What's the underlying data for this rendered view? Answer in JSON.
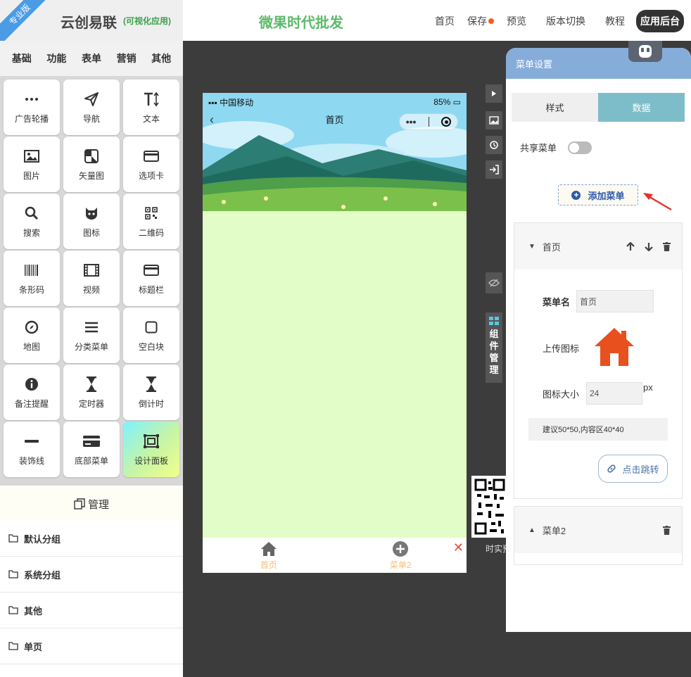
{
  "header": {
    "edition_ribbon": "专业版",
    "brand_name": "云创易联",
    "brand_sub": "(可视化应用)",
    "site_title": "微果时代批发",
    "nav": {
      "home": "首页",
      "save": "保存",
      "preview": "预览",
      "version_switch": "版本切换",
      "tutorial": "教程",
      "admin": "应用后台"
    }
  },
  "sidebar": {
    "category_tabs": [
      "基础",
      "功能",
      "表单",
      "营销",
      "其他"
    ],
    "components": [
      {
        "label": "广告轮播",
        "icon": "more-dots-icon"
      },
      {
        "label": "导航",
        "icon": "paper-plane-icon"
      },
      {
        "label": "文本",
        "icon": "text-size-icon"
      },
      {
        "label": "图片",
        "icon": "image-icon"
      },
      {
        "label": "矢量图",
        "icon": "vector-icon"
      },
      {
        "label": "选项卡",
        "icon": "card-icon"
      },
      {
        "label": "搜索",
        "icon": "search-icon"
      },
      {
        "label": "图标",
        "icon": "github-icon"
      },
      {
        "label": "二维码",
        "icon": "qrcode-icon"
      },
      {
        "label": "条形码",
        "icon": "barcode-icon"
      },
      {
        "label": "视频",
        "icon": "film-icon"
      },
      {
        "label": "标题栏",
        "icon": "titlebar-icon"
      },
      {
        "label": "地图",
        "icon": "compass-icon"
      },
      {
        "label": "分类菜单",
        "icon": "menu-lines-icon"
      },
      {
        "label": "空白块",
        "icon": "blank-square-icon"
      },
      {
        "label": "备注提醒",
        "icon": "info-icon"
      },
      {
        "label": "定时器",
        "icon": "hourglass-icon"
      },
      {
        "label": "倒计时",
        "icon": "hourglass-icon"
      },
      {
        "label": "装饰线",
        "icon": "divider-line-icon"
      },
      {
        "label": "底部菜单",
        "icon": "bottom-menu-icon"
      },
      {
        "label": "设计面板",
        "icon": "design-panel-icon"
      }
    ],
    "manage_label": "管理",
    "groups": [
      "默认分组",
      "系统分组",
      "其他",
      "单页"
    ]
  },
  "phone": {
    "status": {
      "carrier": "中国移动",
      "battery": "85%"
    },
    "nav_title": "首页",
    "tabs": [
      {
        "label": "首页",
        "icon": "home-icon"
      },
      {
        "label": "菜单2",
        "icon": "plus-circle-icon"
      }
    ]
  },
  "tools": {
    "component_manage": [
      "组",
      "件",
      "管",
      "理"
    ],
    "qr_label": "时实预"
  },
  "panel": {
    "title": "菜单设置",
    "seg_style": "样式",
    "seg_data": "数据",
    "share_label": "共享菜单",
    "add_menu": "添加菜单",
    "menu1": {
      "title": "首页",
      "name_label": "菜单名",
      "name_value": "首页",
      "upload_label": "上传图标",
      "size_label": "图标大小",
      "size_value": "24",
      "size_unit": "px",
      "hint": "建议50*50,内容区40*40",
      "jump_label": "点击跳转"
    },
    "menu2": {
      "title": "菜单2"
    }
  },
  "colors": {
    "brand_green": "#5cba6a",
    "panel_header": "#86acd9",
    "seg_active": "#7dbdc9",
    "phone_bg": "#e2fdc8",
    "home_icon": "#e8501e",
    "tab_text": "#f2c07a"
  }
}
